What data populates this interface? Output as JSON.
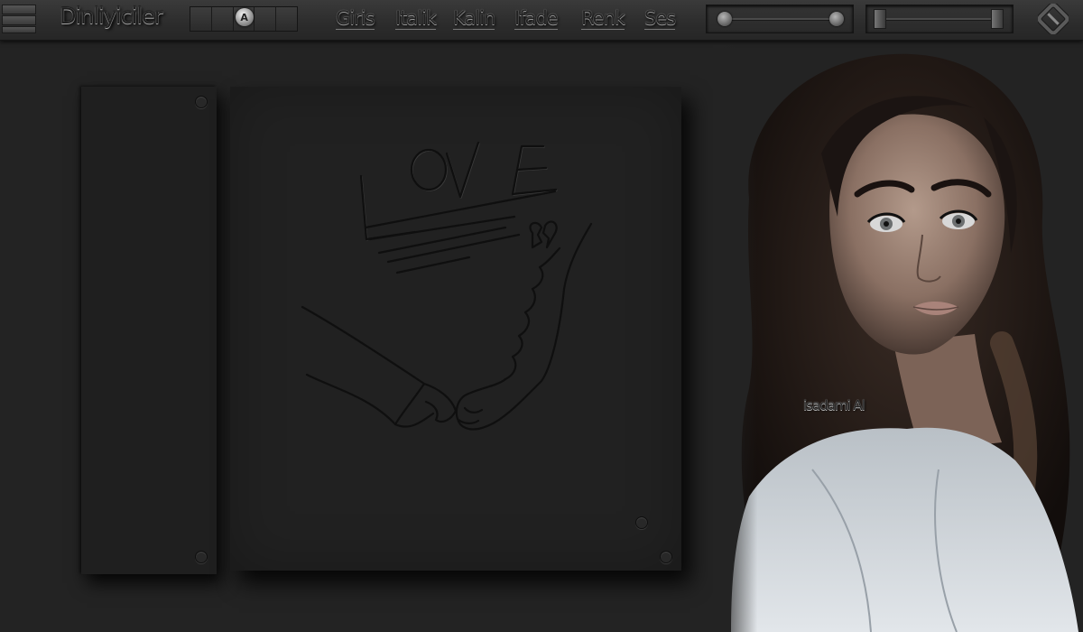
{
  "toolbar": {
    "room_title": "Dinliyiciler",
    "menu": [
      {
        "label": "Giris"
      },
      {
        "label": "Italik"
      },
      {
        "label": "Kalin"
      },
      {
        "label": "Ifade"
      },
      {
        "label": "Renk"
      },
      {
        "label": "Ses"
      }
    ],
    "font_size_knob": "A"
  },
  "stage": {
    "sketch_text": "LOVE"
  },
  "portrait": {
    "label": "isadami Al"
  },
  "colors": {
    "background": "#232323",
    "toolbar": "#2c2c2c",
    "panel": "#212121",
    "emboss_highlight": "#9a9a9a"
  },
  "icons": [
    "menu-icon",
    "font-size-knob-icon",
    "app-logo-icon",
    "screw-icon"
  ]
}
